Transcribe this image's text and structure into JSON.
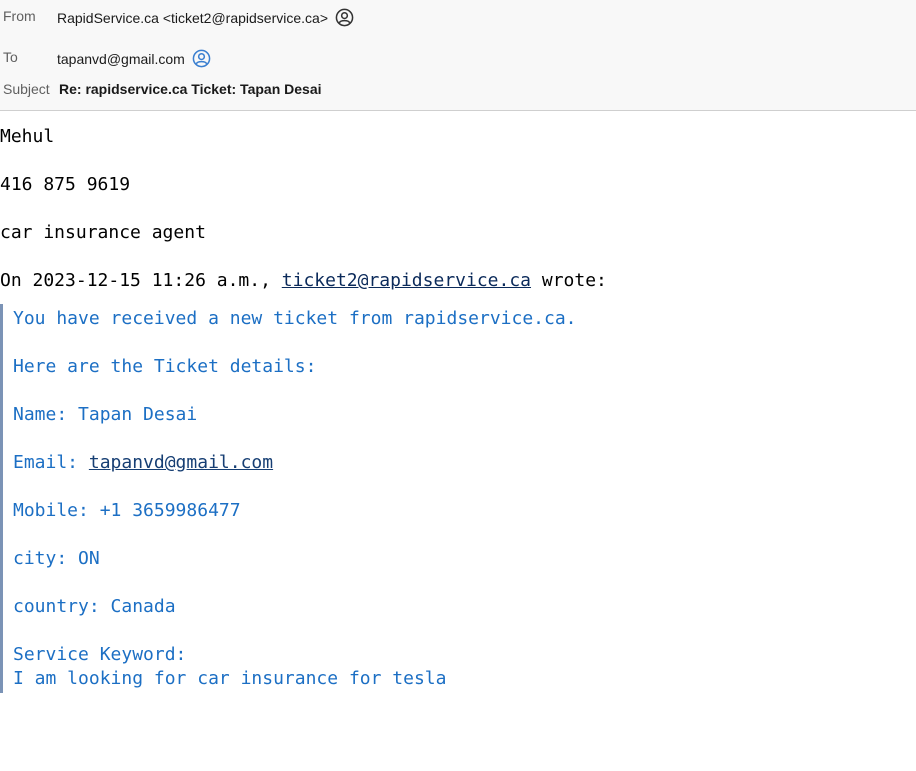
{
  "header": {
    "from_label": "From",
    "from_value": "RapidService.ca <ticket2@rapidservice.ca>",
    "from_icon": "person-circle-icon",
    "to_label": "To",
    "to_value": "tapanvd@gmail.com",
    "to_icon": "person-circle-icon",
    "subject_label": "Subject",
    "subject_value": "Re: rapidservice.ca Ticket: Tapan Desai"
  },
  "message": {
    "line1": "Mehul",
    "line2": "416 875 9619",
    "line3": "car insurance agent",
    "reply_prefix": "On 2023-12-15 11:26 a.m., ",
    "reply_email": "ticket2@rapidservice.ca",
    "reply_suffix": " wrote:"
  },
  "quote": {
    "intro": "You have received a new ticket from rapidservice.ca.",
    "details_heading": "Here are the Ticket details:",
    "name": "Name: Tapan Desai",
    "email_label": "Email: ",
    "email_value": "tapanvd@gmail.com",
    "mobile": "Mobile: +1 3659986477",
    "city": "city: ON",
    "country": "country: Canada",
    "service_keyword_label": "Service Keyword:",
    "service_keyword_value": "I am looking for car insurance for tesla"
  },
  "colors": {
    "header_bg": "#f8f8f8",
    "quote_text": "#1c6fc4",
    "quote_bar": "#7b93b6",
    "to_icon": "#3a7fd0"
  }
}
